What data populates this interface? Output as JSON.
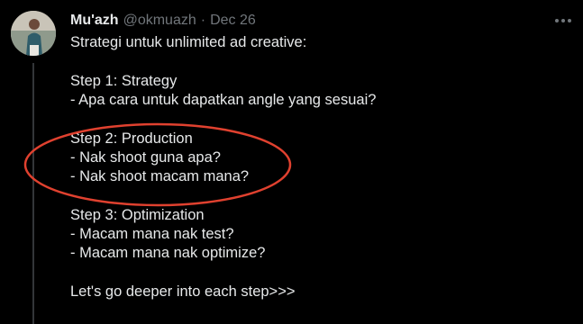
{
  "author": {
    "display_name": "Mu'azh",
    "handle": "@okmuazh",
    "separator": "·",
    "date": "Dec 26"
  },
  "tweet": {
    "intro": "Strategi untuk unlimited ad creative:",
    "steps": [
      {
        "title": "Step 1: Strategy",
        "lines": [
          "- Apa cara untuk dapatkan angle yang sesuai?"
        ]
      },
      {
        "title": "Step 2: Production",
        "lines": [
          "- Nak shoot guna apa?",
          "- Nak shoot macam mana?"
        ]
      },
      {
        "title": "Step 3: Optimization",
        "lines": [
          "- Macam mana nak test?",
          "- Macam mana nak optimize?"
        ]
      }
    ],
    "outro": "Let's go deeper into each step>>>"
  },
  "icons": {
    "more": "more-options-icon"
  },
  "colors": {
    "background": "#000000",
    "text_primary": "#e7e9ea",
    "text_secondary": "#71767b",
    "annotation": "#e0412f",
    "thread_line": "#333639"
  }
}
